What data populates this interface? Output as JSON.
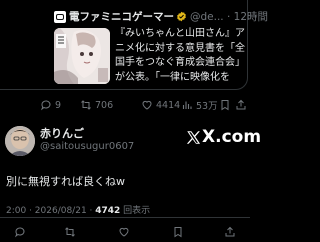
{
  "quoted_tweet": {
    "account_name": "電ファミニコゲーマー",
    "handle_time": "@de... · 12時間",
    "text": "『みいちゃんと山田さん』アニメ化に対する意見書を「全国手をつなぐ育成会連合会」が公表。「一律に映像化を反...",
    "icons": {
      "avatar": "game-controller-avatar",
      "verified": "gold-verified-badge"
    },
    "actions": {
      "reply_count": "9",
      "retweet_count": "706",
      "like_count": "4414",
      "view_count": "53万"
    }
  },
  "reply": {
    "display_name": "赤りんご",
    "handle": "@saitousugur0607",
    "watermark": "X.com",
    "body": "別に無視すれば良くねw",
    "timestamp": "2:00 · 2026/08/21 · ",
    "views_count": "4742",
    "views_label": " 回表示"
  },
  "colors": {
    "background": "#000000",
    "text_primary": "#e7e9ea",
    "text_secondary": "#71767b",
    "border": "#2f3336",
    "verified": "#e2b719"
  }
}
